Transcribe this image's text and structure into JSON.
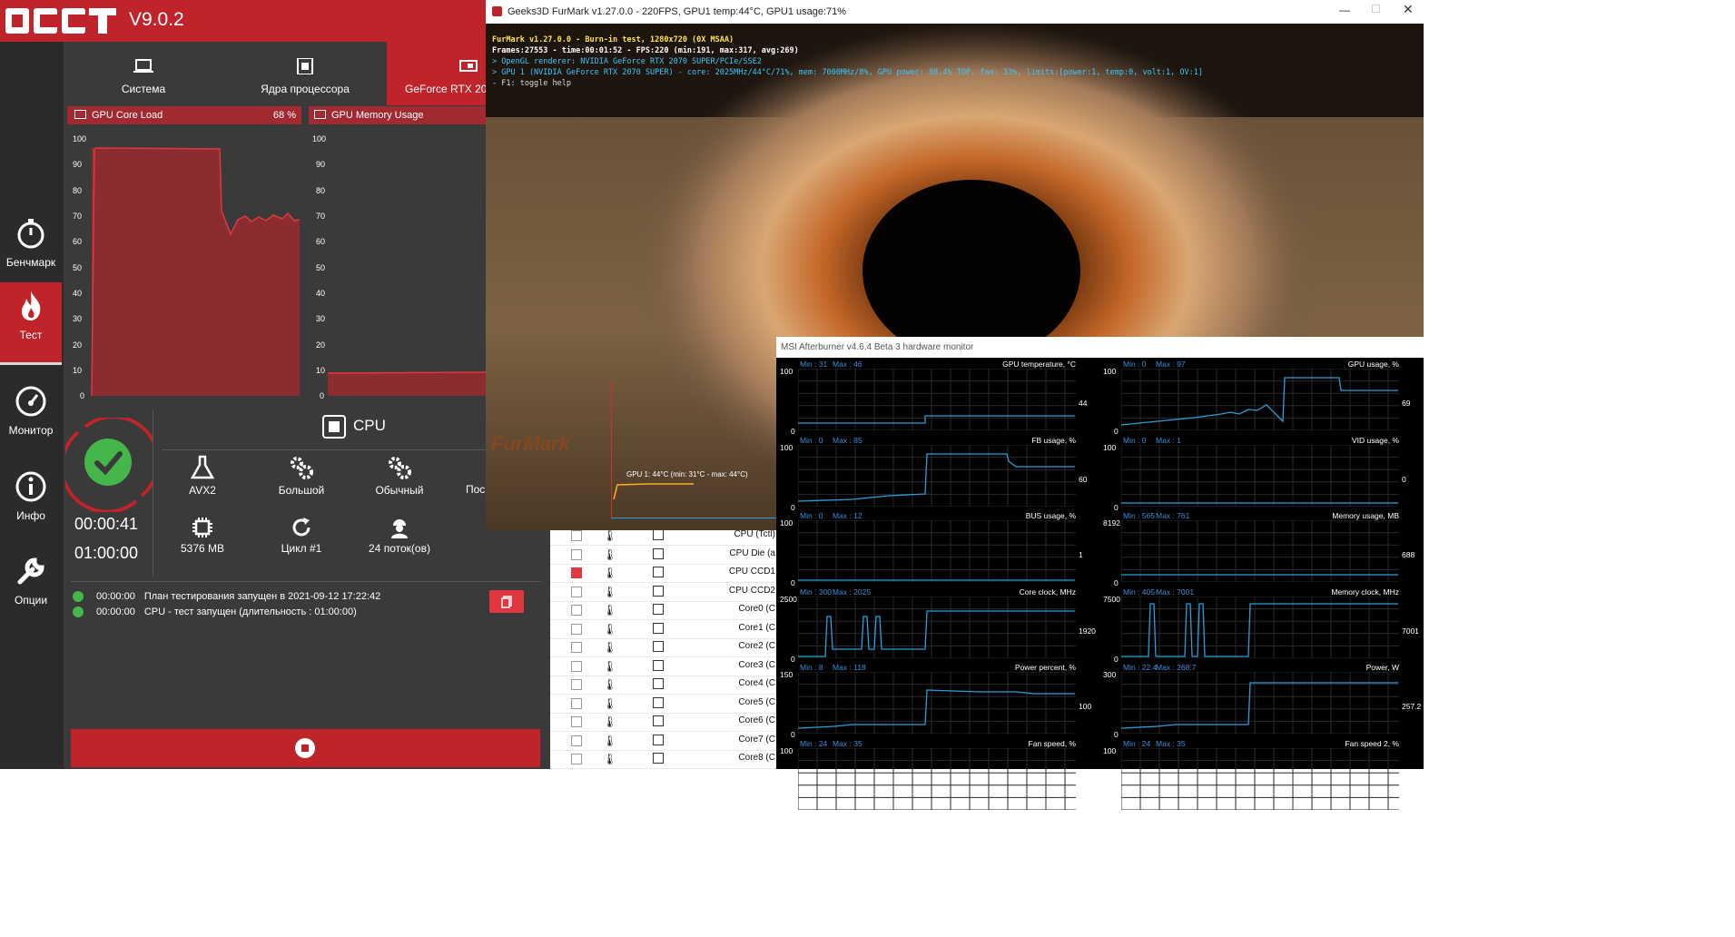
{
  "occt": {
    "version": "V9.0.2",
    "sidebar": [
      "Бенчмарк",
      "Тест",
      "Монитор",
      "Инфо",
      "Опции"
    ],
    "tabs": [
      "Система",
      "Ядра процессора",
      "GeForce RTX 20"
    ],
    "gpu_core_title": "GPU Core Load",
    "gpu_core_value": "68 %",
    "gpu_mem_title": "GPU Memory Usage",
    "y_ticks": [
      "100",
      "90",
      "80",
      "70",
      "60",
      "50",
      "40",
      "30",
      "20",
      "10",
      "0"
    ],
    "test_name": "CPU",
    "options": [
      "AVX2",
      "Большой",
      "Обычный",
      "Пос"
    ],
    "stats": [
      "5376 MB",
      "Цикл #1",
      "24 поток(ов)"
    ],
    "elapsed": "00:00:41",
    "duration": "01:00:00",
    "log": [
      {
        "time": "00:00:00",
        "text": "План тестирования запущен в 2021-09-12 17:22:42"
      },
      {
        "time": "00:00:00",
        "text": "CPU - тест запущен (длительность : 01:00:00)"
      }
    ]
  },
  "furmark": {
    "title": "Geeks3D FurMark v1.27.0.0 - 220FPS, GPU1 temp:44°C, GPU1 usage:71%",
    "lines": [
      "FurMark v1.27.0.0 - Burn-in test, 1280x720 (0X MSAA)",
      "Frames:27553 - time:00:01:52 - FPS:220 (min:191, max:317, avg:269)",
      "> OpenGL renderer: NVIDIA GeForce RTX 2070 SUPER/PCIe/SSE2",
      "> GPU 1 (NVIDIA GeForce RTX 2070 SUPER) - core: 2025MHz/44°C/71%, mem: 7000MHz/8%, GPU power: 88.4% TDP, fan: 33%, limits:[power:1, temp:0, volt:1, OV:1]",
      "- F1: toggle help"
    ],
    "gpu_temp": "GPU 1: 44°C (min: 31°C - max: 44°C)",
    "logo": "FurMark"
  },
  "checklist": [
    {
      "label": "CPU (Tctl)",
      "checked": false
    },
    {
      "label": "CPU Die (a",
      "checked": false
    },
    {
      "label": "CPU CCD1",
      "checked": true
    },
    {
      "label": "CPU CCD2",
      "checked": false
    },
    {
      "label": "Core0 (C",
      "checked": false
    },
    {
      "label": "Core1 (C",
      "checked": false
    },
    {
      "label": "Core2 (C",
      "checked": false
    },
    {
      "label": "Core3 (C",
      "checked": false
    },
    {
      "label": "Core4 (C",
      "checked": false
    },
    {
      "label": "Core5 (C",
      "checked": false
    },
    {
      "label": "Core6 (C",
      "checked": false
    },
    {
      "label": "Core7 (C",
      "checked": false
    },
    {
      "label": "Core8 (C",
      "checked": false
    }
  ],
  "afterburner": {
    "title": "MSI Afterburner v4.6.4 Beta 3 hardware monitor",
    "graphs": [
      {
        "name": "GPU temperature, °C",
        "min": "Min : 31",
        "max": "Max : 46",
        "top": "100",
        "bottom": "0",
        "current": "44"
      },
      {
        "name": "GPU usage, %",
        "min": "Min : 0",
        "max": "Max : 97",
        "top": "100",
        "bottom": "0",
        "current": "69"
      },
      {
        "name": "FB usage, %",
        "min": "Min : 0",
        "max": "Max : 85",
        "top": "100",
        "bottom": "0",
        "current": "60"
      },
      {
        "name": "VID usage, %",
        "min": "Min : 0",
        "max": "Max : 1",
        "top": "100",
        "bottom": "0",
        "current": "0"
      },
      {
        "name": "BUS usage, %",
        "min": "Min : 0",
        "max": "Max : 12",
        "top": "100",
        "bottom": "0",
        "current": "1"
      },
      {
        "name": "Memory usage, MB",
        "min": "Min : 565",
        "max": "Max : 761",
        "top": "8192",
        "bottom": "0",
        "current": "688"
      },
      {
        "name": "Core clock, MHz",
        "min": "Min : 300",
        "max": "Max : 2025",
        "top": "2500",
        "bottom": "0",
        "current": "1920"
      },
      {
        "name": "Memory clock, MHz",
        "min": "Min : 405",
        "max": "Max : 7001",
        "top": "7500",
        "bottom": "0",
        "current": "7001"
      },
      {
        "name": "Power percent, %",
        "min": "Min : 8",
        "max": "Max : 118",
        "top": "150",
        "bottom": "0",
        "current": "100"
      },
      {
        "name": "Power, W",
        "min": "Min : 22.4",
        "max": "Max : 268.7",
        "top": "300",
        "bottom": "0",
        "current": "257.2"
      },
      {
        "name": "Fan speed, %",
        "min": "Min : 24",
        "max": "Max : 35",
        "top": "100",
        "bottom": "",
        "current": ""
      },
      {
        "name": "Fan speed 2, %",
        "min": "Min : 24",
        "max": "Max : 35",
        "top": "100",
        "bottom": "",
        "current": ""
      }
    ]
  },
  "colors": {
    "occt_red": "#c0242b",
    "ab_line": "#2aa0d8",
    "ok_green": "#45b649"
  }
}
